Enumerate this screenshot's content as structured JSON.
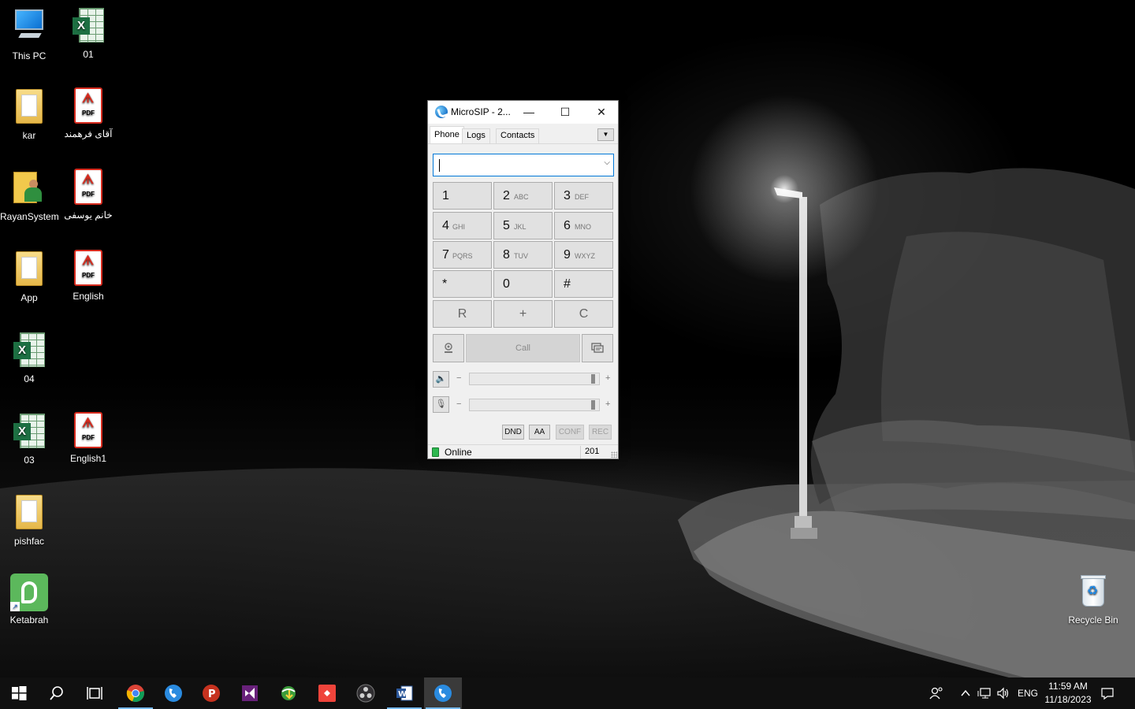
{
  "desktop": {
    "icons": [
      {
        "label": "This PC",
        "kind": "computer"
      },
      {
        "label": "01",
        "kind": "excel"
      },
      {
        "label": "kar",
        "kind": "folder"
      },
      {
        "label": "آقای فرهمند",
        "kind": "pdf"
      },
      {
        "label": "RayanSystem",
        "kind": "folder-person"
      },
      {
        "label": "خانم یوسفی",
        "kind": "pdf"
      },
      {
        "label": "App",
        "kind": "folder"
      },
      {
        "label": "English",
        "kind": "pdf"
      },
      {
        "label": "04",
        "kind": "excel"
      },
      {
        "label": "03",
        "kind": "excel"
      },
      {
        "label": "English1",
        "kind": "pdf"
      },
      {
        "label": "pishfac",
        "kind": "folder"
      },
      {
        "label": "Ketabrah",
        "kind": "app-shortcut"
      },
      {
        "label": "Recycle Bin",
        "kind": "recycle-bin"
      }
    ],
    "pdf_badge": "PDF",
    "excel_badge": "X"
  },
  "microsip": {
    "title": "MicroSIP - 2...",
    "tabs": [
      "Phone",
      "Logs",
      "Contacts"
    ],
    "active_tab": "Phone",
    "dial_value": "",
    "keys": [
      {
        "digit": "1",
        "letters": ""
      },
      {
        "digit": "2",
        "letters": "ABC"
      },
      {
        "digit": "3",
        "letters": "DEF"
      },
      {
        "digit": "4",
        "letters": "GHI"
      },
      {
        "digit": "5",
        "letters": "JKL"
      },
      {
        "digit": "6",
        "letters": "MNO"
      },
      {
        "digit": "7",
        "letters": "PQRS"
      },
      {
        "digit": "8",
        "letters": "TUV"
      },
      {
        "digit": "9",
        "letters": "WXYZ"
      },
      {
        "digit": "*",
        "letters": ""
      },
      {
        "digit": "0",
        "letters": ""
      },
      {
        "digit": "#",
        "letters": ""
      }
    ],
    "action_keys": [
      "R",
      "+",
      "C"
    ],
    "call_label": "Call",
    "speaker_level": 0.97,
    "mic_level": 0.97,
    "minus": "−",
    "plus": "+",
    "toggles": [
      {
        "label": "DND",
        "enabled": true
      },
      {
        "label": "AA",
        "enabled": true
      },
      {
        "label": "CONF",
        "enabled": false
      },
      {
        "label": "REC",
        "enabled": false
      }
    ],
    "status": "Online",
    "extension": "201",
    "status_color": "#2db84f"
  },
  "taskbar": {
    "apps": [
      "start",
      "search",
      "task-view",
      "chrome",
      "microsip",
      "proxifier",
      "visual-studio",
      "internet-download-manager",
      "anydesk",
      "obs",
      "word",
      "microsip-active"
    ],
    "tray_language": "ENG",
    "time": "11:59 AM",
    "date": "11/18/2023"
  }
}
